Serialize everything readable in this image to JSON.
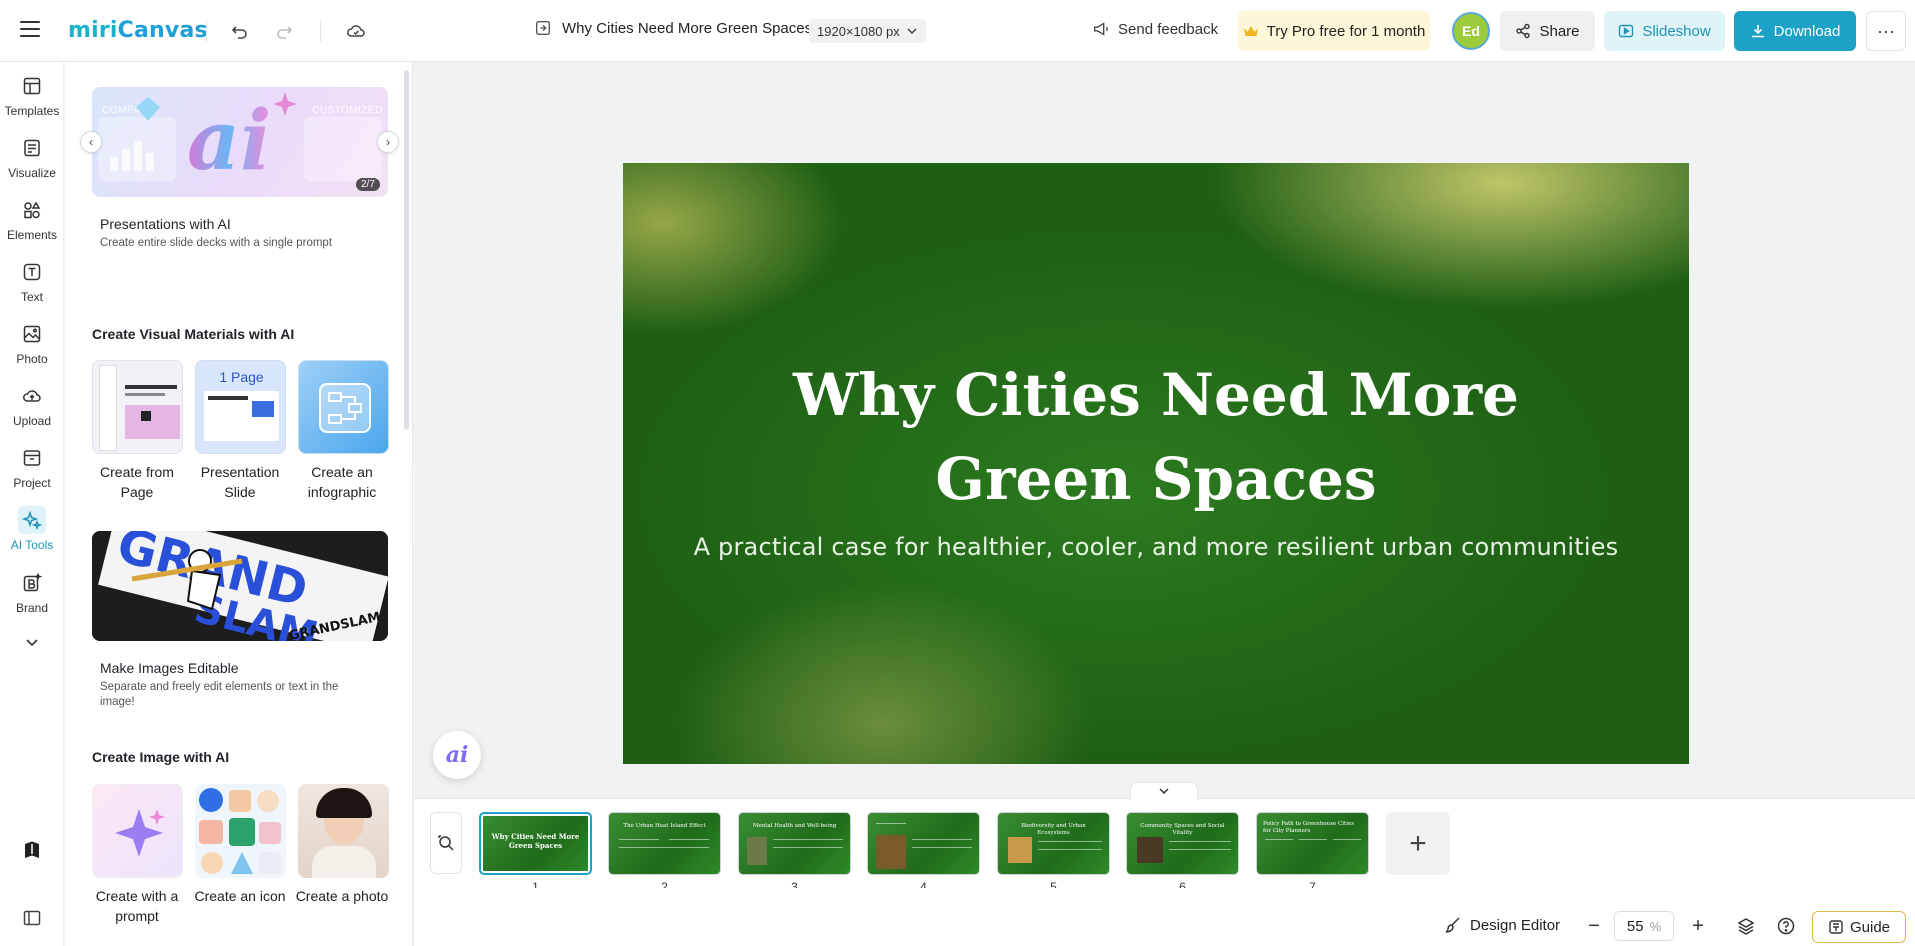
{
  "app": {
    "logo_text_main": "miri",
    "logo_text_accent": "Canvas"
  },
  "header": {
    "doc_title": "Why Cities Need More Green Spaces",
    "size_label": "1920×1080 px",
    "feedback_label": "Send feedback",
    "pro_label": "Try Pro free for 1 month",
    "avatar_initials": "Ed",
    "share_label": "Share",
    "slideshow_label": "Slideshow",
    "download_label": "Download",
    "more_label": "···"
  },
  "rail": {
    "items": [
      {
        "label": "Templates",
        "icon": "templates-icon"
      },
      {
        "label": "Visualize",
        "icon": "visualize-icon"
      },
      {
        "label": "Elements",
        "icon": "elements-icon"
      },
      {
        "label": "Text",
        "icon": "text-icon"
      },
      {
        "label": "Photo",
        "icon": "photo-icon"
      },
      {
        "label": "Upload",
        "icon": "upload-icon"
      },
      {
        "label": "Project",
        "icon": "project-icon"
      },
      {
        "label": "AI Tools",
        "icon": "ai-tools-icon"
      },
      {
        "label": "Brand",
        "icon": "brand-icon"
      }
    ],
    "active_index": 7
  },
  "panel": {
    "hero": {
      "ghost_left": "COMPARE",
      "ghost_right": "CUSTOMIZED",
      "counter": "2/7",
      "title": "Presentations with AI",
      "desc": "Create entire slide decks with a single prompt"
    },
    "visual_section": {
      "heading": "Create Visual Materials with AI",
      "tiles": [
        {
          "label": "Create from Page"
        },
        {
          "label": "Presentation Slide",
          "badge": "1 Page"
        },
        {
          "label": "Create an infographic"
        }
      ]
    },
    "editable": {
      "image_text": "GRANDSLAM",
      "title": "Make Images Editable",
      "desc": "Separate and freely edit elements or text in the image!"
    },
    "image_section": {
      "heading": "Create Image with AI",
      "tiles": [
        {
          "label": "Create with a prompt"
        },
        {
          "label": "Create an icon"
        },
        {
          "label": "Create a photo"
        }
      ]
    }
  },
  "slide": {
    "title": "Why Cities Need More Green Spaces",
    "subtitle": "A practical case for healthier, cooler, and more resilient urban communities"
  },
  "ai_fab_label": "ai",
  "filmstrip": {
    "thumbnails": [
      {
        "num": "1",
        "title": "Why Cities Need More Green Spaces"
      },
      {
        "num": "2",
        "title": "The Urban Heat Island Effect"
      },
      {
        "num": "3",
        "title": "Mental Health and Well-being"
      },
      {
        "num": "4",
        "title": ""
      },
      {
        "num": "5",
        "title": "Biodiversity and Urban Ecosystems"
      },
      {
        "num": "6",
        "title": "Community Spaces and Social Vitality"
      },
      {
        "num": "7",
        "title": "Policy Path to Greenhouse Cities for City Planners"
      }
    ],
    "active_index": 0,
    "add_label": "+"
  },
  "statusbar": {
    "design_editor_label": "Design Editor",
    "zoom_value": "55",
    "zoom_unit": "%",
    "guide_label": "Guide"
  },
  "colors": {
    "accent": "#1ea1c6",
    "pro_bg": "#fdf6d8",
    "slide_green": "#1e5f14"
  }
}
